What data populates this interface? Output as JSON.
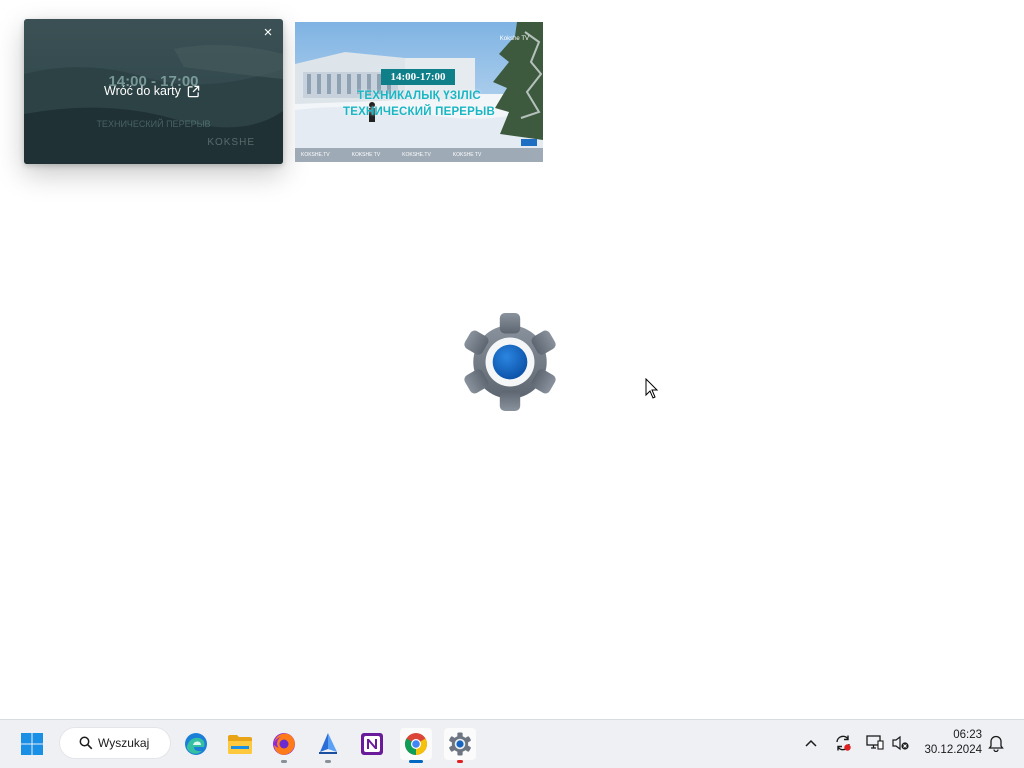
{
  "pip_popup": {
    "back_to_tab_label": "Wróć do karty",
    "close_glyph": "×",
    "ghost_time": "14:00 - 17:00",
    "ghost_subtitle": "ТЕХНИЧЕСКИЙ ПЕРЕРЫВ",
    "ghost_brand": "KOKSHE"
  },
  "video_thumbnail": {
    "time_badge": "14:00-17:00",
    "line1": "ТЕХНИКАЛЫҚ ҮЗІЛІС",
    "line2": "ТЕХНИЧЕСКИЙ ПЕРЕРЫВ",
    "corner_tag": "Kokshe TV",
    "footer_items": [
      "KOKSHE.TV",
      "KOKSHE TV",
      "KOKSHE.TV",
      "KOKSHE TV"
    ]
  },
  "taskbar": {
    "search_label": "Wyszukaj",
    "apps": [
      {
        "name": "Microsoft Edge",
        "icon": "edge-icon"
      },
      {
        "name": "File Explorer",
        "icon": "folder-icon"
      },
      {
        "name": "Firefox",
        "icon": "firefox-icon"
      },
      {
        "name": "Sailing app",
        "icon": "sail-icon"
      },
      {
        "name": "Notion",
        "icon": "notion-icon"
      },
      {
        "name": "Google Chrome",
        "icon": "chrome-icon"
      },
      {
        "name": "Settings",
        "icon": "settings-icon"
      }
    ],
    "clock_time": "06:23",
    "clock_date": "30.12.2024"
  },
  "colors": {
    "accent": "#0067c0",
    "teal_badge": "#0f7f8a",
    "teal_text": "#19b6c4",
    "taskbar_bg": "#eef0f4"
  }
}
